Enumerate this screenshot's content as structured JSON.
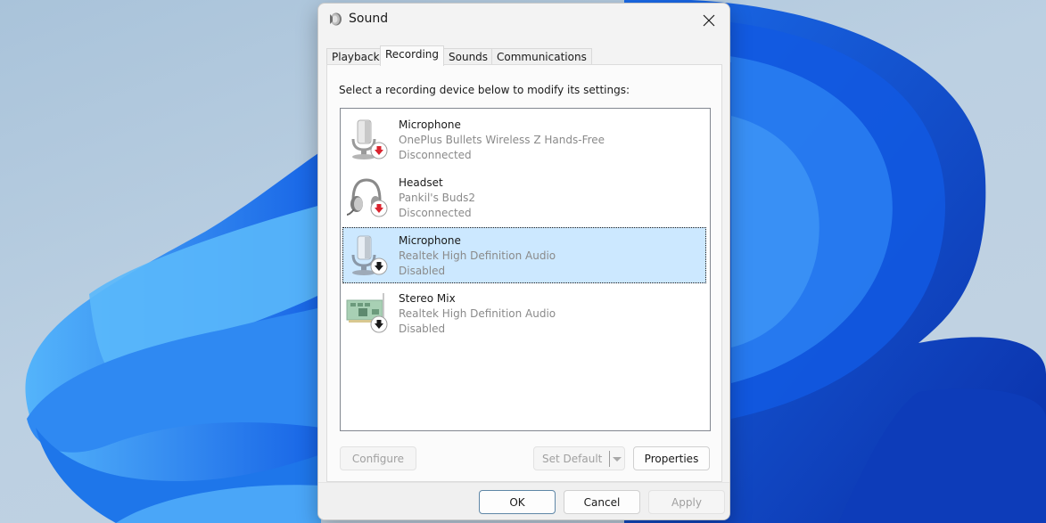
{
  "window": {
    "title": "Sound",
    "icon": "speaker-icon",
    "close_icon": "close-icon"
  },
  "tabs": [
    {
      "label": "Playback",
      "active": false
    },
    {
      "label": "Recording",
      "active": true
    },
    {
      "label": "Sounds",
      "active": false
    },
    {
      "label": "Communications",
      "active": false
    }
  ],
  "recording": {
    "instruction": "Select a recording device below to modify its settings:",
    "devices": [
      {
        "name": "Microphone",
        "description": "OnePlus Bullets Wireless Z Hands-Free",
        "status": "Disconnected",
        "icon": "microphone-icon",
        "badge": "disconnected-badge-icon",
        "selected": false
      },
      {
        "name": "Headset",
        "description": "Pankil's Buds2",
        "status": "Disconnected",
        "icon": "headset-icon",
        "badge": "disconnected-badge-icon",
        "selected": false
      },
      {
        "name": "Microphone",
        "description": "Realtek High Definition Audio",
        "status": "Disabled",
        "icon": "microphone-icon",
        "badge": "disabled-badge-icon",
        "selected": true
      },
      {
        "name": "Stereo Mix",
        "description": "Realtek High Definition Audio",
        "status": "Disabled",
        "icon": "sound-card-icon",
        "badge": "disabled-badge-icon",
        "selected": false
      }
    ],
    "buttons": {
      "configure": "Configure",
      "set_default": "Set Default",
      "properties": "Properties"
    }
  },
  "footer": {
    "ok": "OK",
    "cancel": "Cancel",
    "apply": "Apply"
  },
  "colors": {
    "selection": "#cce8ff",
    "disconnected_badge": "#d9232e",
    "disabled_badge": "#1a1a1a"
  }
}
